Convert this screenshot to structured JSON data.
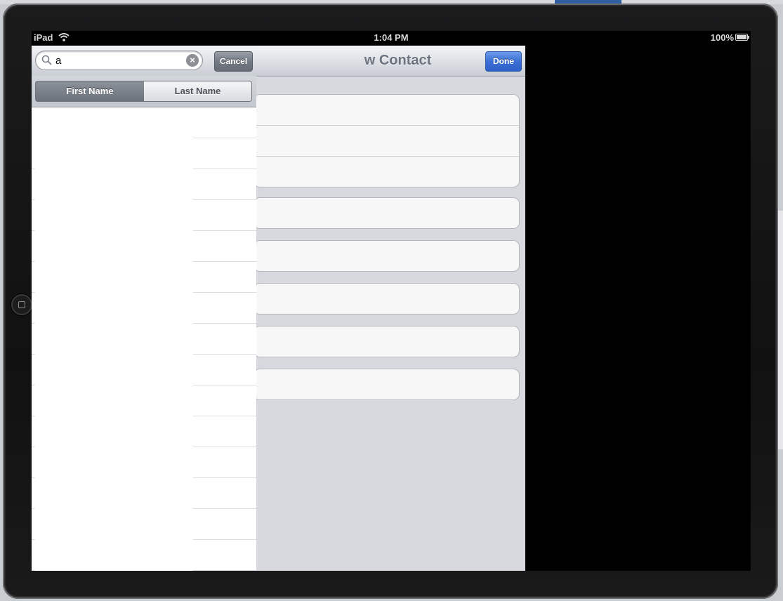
{
  "status_bar": {
    "carrier": "iPad",
    "time": "1:04 PM",
    "battery": "100%"
  },
  "new_contact": {
    "title_fragment": "w Contact",
    "done_label": "Done"
  },
  "search": {
    "query": "a",
    "cancel_label": "Cancel",
    "scopes": [
      "First Name",
      "Last Name"
    ],
    "selected_scope": "First Name"
  }
}
